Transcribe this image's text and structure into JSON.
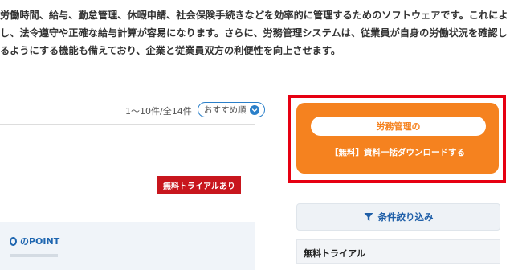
{
  "intro": {
    "lines": [
      "労働時間、給与、勤怠管理、休暇申請、社会保険手続きなどを効率的に管理するためのソフトウェアです。これによ",
      "し、法令遵守や正確な給与計算が容易になります。さらに、労務管理システムは、従業員が自身の労働状況を確認し",
      "るようにする機能も備えており、企業と従業員双方の利便性を向上させます。"
    ]
  },
  "listing": {
    "result_count": "1～10件/全14件",
    "sort_label": "おすすめ順",
    "trial_badge": "無料トライアルあり",
    "point_title": "のPOINT"
  },
  "cta": {
    "pill_text": "労務管理の",
    "download_label": "【無料】資料一括ダウンロードする"
  },
  "sidebar": {
    "filter_label": "条件絞り込み",
    "panel_title": "無料トライアル"
  },
  "colors": {
    "accent_orange": "#f5821f",
    "highlight_red": "#e60012",
    "badge_red": "#c8161d",
    "link_blue": "#2a7fc9"
  },
  "icons": {
    "sort": "chevron-down-icon",
    "filter": "filter-icon",
    "point": "point-icon"
  }
}
